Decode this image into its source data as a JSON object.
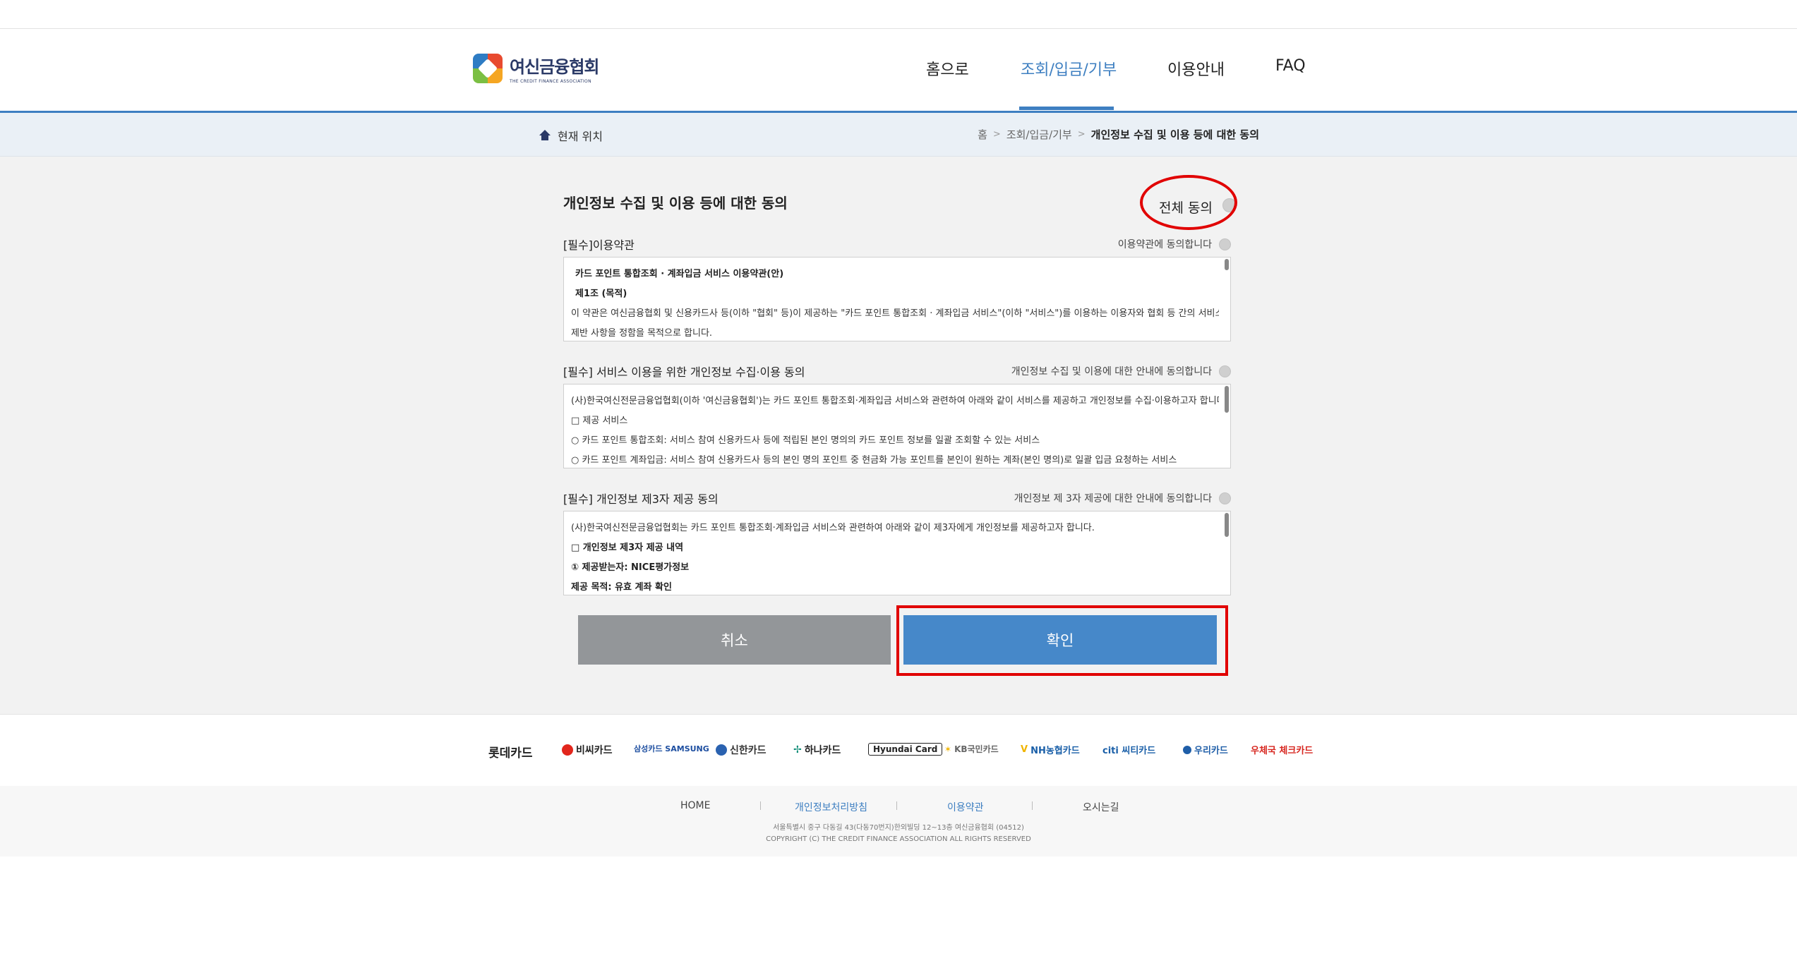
{
  "header": {
    "logo_main": "여신금융협회",
    "logo_sub": "THE CREDIT FINANCE ASSOCIATION",
    "nav": [
      {
        "label": "홈으로"
      },
      {
        "label": "조회/입금/기부"
      },
      {
        "label": "이용안내"
      },
      {
        "label": "FAQ"
      }
    ]
  },
  "breadcrumb": {
    "current_location_label": "현재 위치",
    "path": [
      "홈",
      "조회/입금/기부",
      "개인정보 수집 및 이용 등에 대한 동의"
    ]
  },
  "main": {
    "title": "개인정보 수집 및 이용 등에 대한 동의",
    "all_agree_label": "전체 동의",
    "blocks": [
      {
        "title": "[필수]이용약관",
        "agree_label": "이용약관에 동의합니다",
        "lines": [
          "카드 포인트 통합조회 · 계좌입금 서비스 이용약관(안)",
          "제1조 (목적)",
          "이 약관은 여신금융협회 및 신용카드사 등(이하 \"협회\" 등)이 제공하는 \"카드 포인트 통합조회 · 계좌입금 서비스\"(이하 \"서비스\")를 이용하는 이용자와 협회 등 간의 서비스 이용에 관한",
          "제반 사항을 정함을 목적으로 합니다."
        ]
      },
      {
        "title": "[필수] 서비스 이용을 위한 개인정보 수집·이용 동의",
        "agree_label": "개인정보 수집 및 이용에 대한 안내에 동의합니다",
        "lines": [
          "(사)한국여신전문금융업협회(이하 '여신금융협회')는 카드 포인트 통합조회·계좌입금 서비스와 관련하여 아래와 같이 서비스를 제공하고 개인정보를 수집·이용하고자 합니다.",
          "□ 제공 서비스",
          "○ 카드 포인트 통합조회: 서비스 참여 신용카드사 등에 적립된 본인 명의의 카드 포인트 정보를 일괄 조회할 수 있는 서비스",
          "○ 카드 포인트 계좌입금: 서비스 참여 신용카드사 등의 본인 명의 포인트 중 현금화 가능 포인트를 본인이 원하는 계좌(본인 명의)로 일괄 입금 요청하는 서비스"
        ]
      },
      {
        "title": "[필수] 개인정보 제3자 제공 동의",
        "agree_label": "개인정보 제 3자 제공에 대한 안내에 동의합니다",
        "lines": [
          "(사)한국여신전문금융업협회는 카드 포인트 통합조회·계좌입금 서비스와 관련하여 아래와 같이 제3자에게 개인정보를 제공하고자 합니다.",
          "□ 개인정보 제3자 제공 내역",
          "① 제공받는자: NICE평가정보",
          "제공 목적: 유효 계좌 확인"
        ]
      }
    ],
    "cancel_label": "취소",
    "confirm_label": "확인"
  },
  "partners": [
    {
      "name": "롯데카드",
      "color": "#222222"
    },
    {
      "name": "비씨카드",
      "color": "#222222",
      "dot": "#e2261c"
    },
    {
      "name": "삼성카드 SAMSUNG",
      "color": "#1d4ea0"
    },
    {
      "name": "신한카드",
      "color": "#333333",
      "dot": "#2a62b0"
    },
    {
      "name": "하나카드",
      "color": "#222222"
    },
    {
      "name": "Hyundai Card",
      "color": "#222222"
    },
    {
      "name": "KB국민카드",
      "color": "#666666"
    },
    {
      "name": "NH농협카드",
      "color": "#1a5fa8"
    },
    {
      "name": "citi 씨티카드",
      "color": "#1a5fa8"
    },
    {
      "name": "우리카드",
      "color": "#1f5ea8",
      "dot": "#1f5ea8"
    },
    {
      "name": "우체국 체크카드",
      "color": "#d7261f"
    }
  ],
  "footer": {
    "links": [
      "HOME",
      "개인정보처리방침",
      "이용약관",
      "오시는길"
    ],
    "address": "서울특별시 중구 다동길 43(다동70번지)한외빌딩 12~13층 여신금융협회 (04512)",
    "copyright": "COPYRIGHT (C) THE CREDIT FINANCE ASSOCIATION ALL RIGHTS RESERVED"
  },
  "colors": {
    "accent": "#3e7fc1",
    "confirm_button": "#4688c9",
    "cancel_button": "#939699",
    "annotation": "#e10000"
  }
}
